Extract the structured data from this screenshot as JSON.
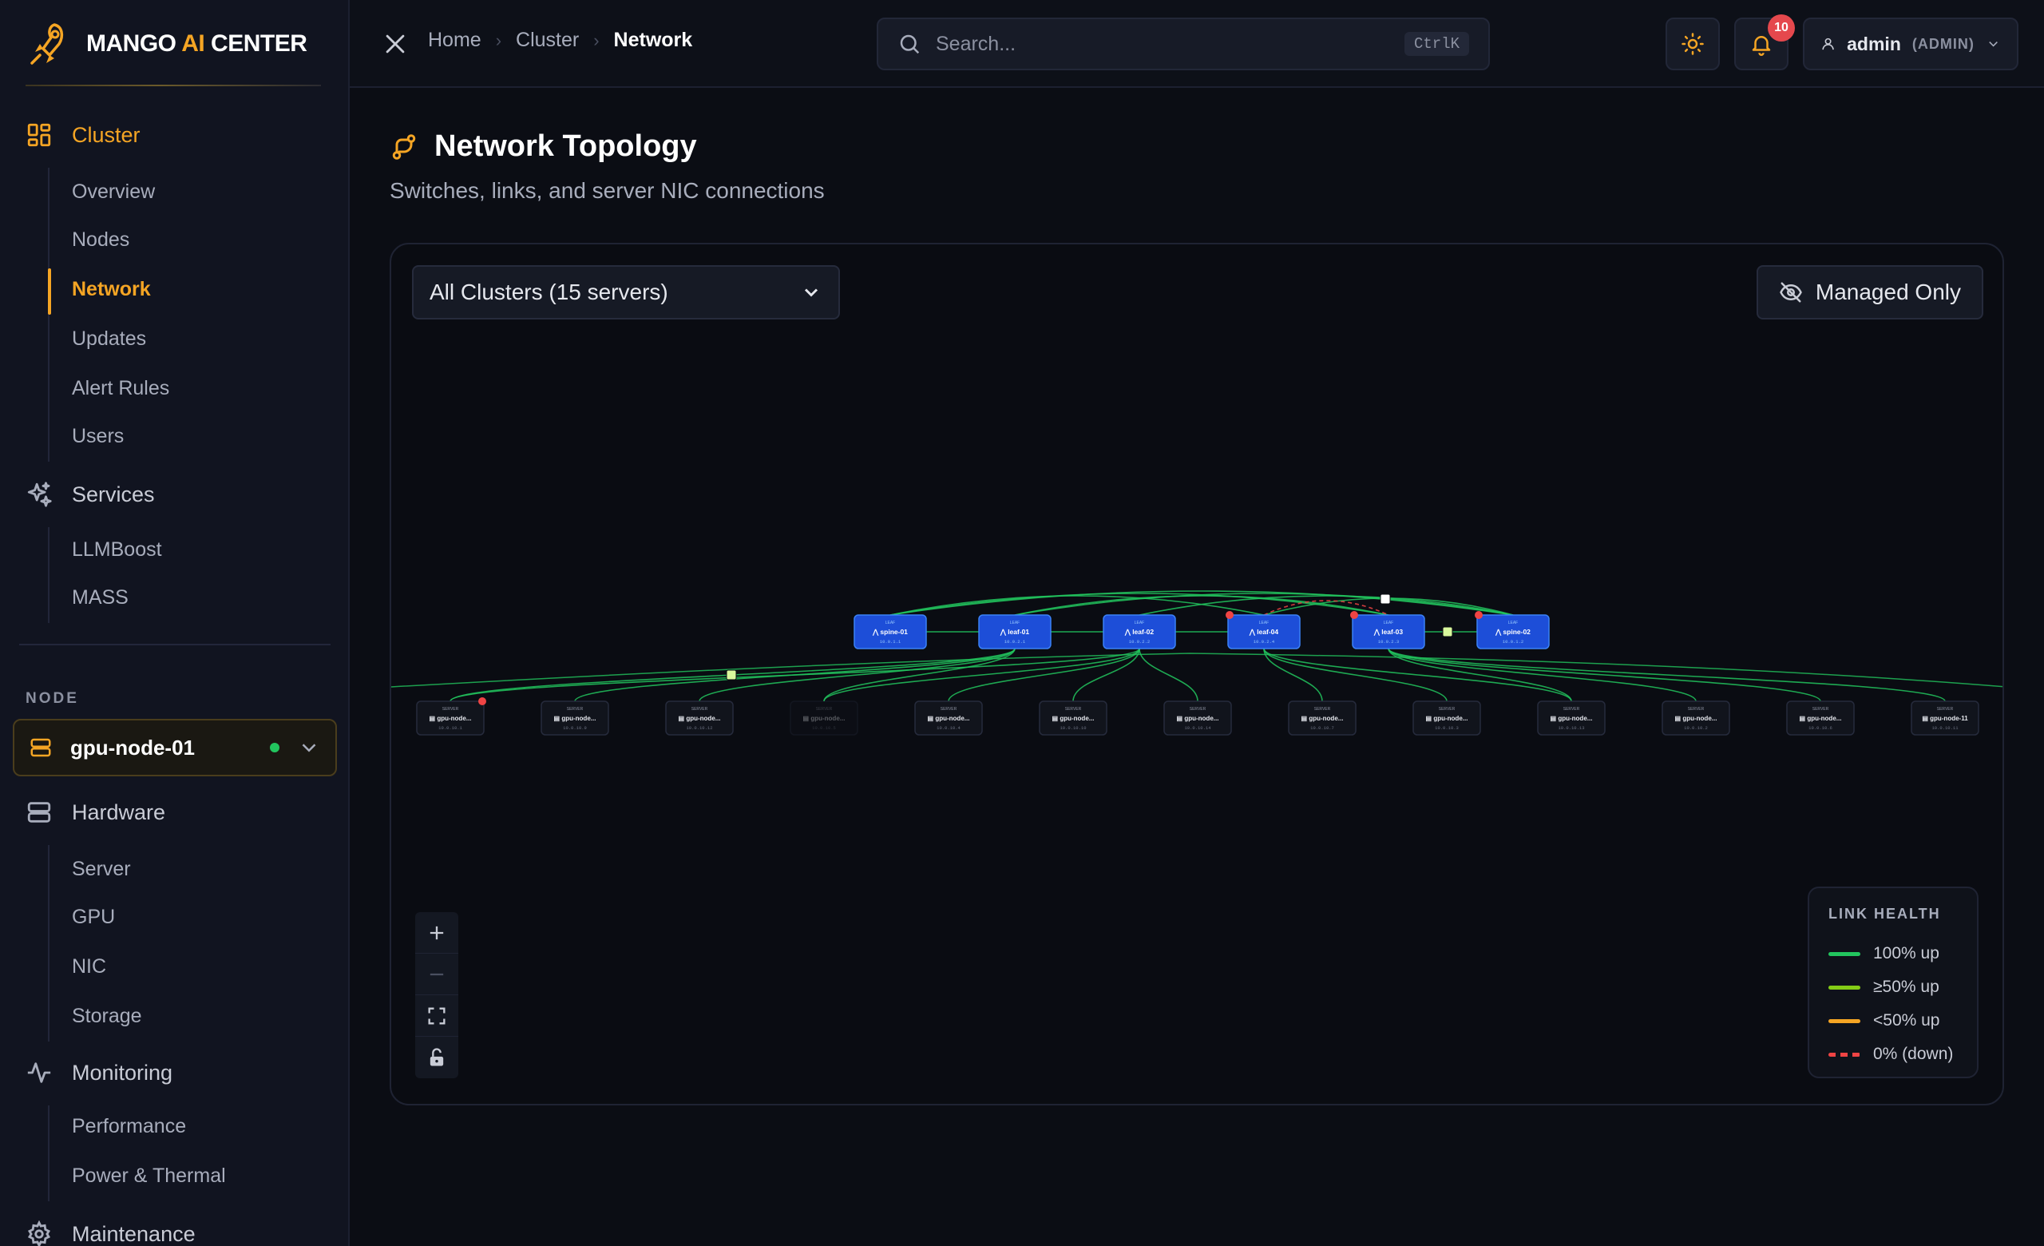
{
  "brand": {
    "name_pre": "MANGO ",
    "name_ai": "AI",
    "name_post": " CENTER"
  },
  "sidebar": {
    "cluster": {
      "label": "Cluster",
      "items": [
        "Overview",
        "Nodes",
        "Network",
        "Updates",
        "Alert Rules",
        "Users"
      ],
      "active": "Network"
    },
    "services": {
      "label": "Services",
      "items": [
        "LLMBoost",
        "MASS"
      ]
    },
    "node_label": "NODE",
    "node_select": {
      "value": "gpu-node-01",
      "status_color": "#22c55e"
    },
    "hardware": {
      "label": "Hardware",
      "items": [
        "Server",
        "GPU",
        "NIC",
        "Storage"
      ]
    },
    "monitoring": {
      "label": "Monitoring",
      "items": [
        "Performance",
        "Power & Thermal"
      ]
    },
    "maintenance": {
      "label": "Maintenance"
    }
  },
  "topbar": {
    "breadcrumb": [
      "Home",
      "Cluster",
      "Network"
    ],
    "search_placeholder": "Search...",
    "search_shortcut": "CtrlK",
    "notification_count": "10",
    "user": {
      "name": "admin",
      "role": "(ADMIN)"
    }
  },
  "page": {
    "title": "Network Topology",
    "subtitle": "Switches, links, and server NIC connections",
    "cluster_filter": "All Clusters (15 servers)",
    "managed_only_label": "Managed Only"
  },
  "topology": {
    "switches": [
      {
        "name": "spine-01",
        "type": "LEAF",
        "ip": "10.0.1.1",
        "alert": false
      },
      {
        "name": "leaf-01",
        "type": "LEAF",
        "ip": "10.0.2.1",
        "alert": false
      },
      {
        "name": "leaf-02",
        "type": "LEAF",
        "ip": "10.0.2.2",
        "alert": false
      },
      {
        "name": "leaf-04",
        "type": "LEAF",
        "ip": "10.0.2.4",
        "alert": true
      },
      {
        "name": "leaf-03",
        "type": "LEAF",
        "ip": "10.0.2.3",
        "alert": true
      },
      {
        "name": "spine-02",
        "type": "LEAF",
        "ip": "10.0.1.2",
        "alert": true
      }
    ],
    "servers": [
      {
        "name": "gpu-node...",
        "type": "SERVER",
        "ip": "10.0.10.1",
        "alert": true,
        "dim": false
      },
      {
        "name": "gpu-node...",
        "type": "SERVER",
        "ip": "10.0.10.9",
        "alert": false,
        "dim": false
      },
      {
        "name": "gpu-node...",
        "type": "SERVER",
        "ip": "10.0.10.12",
        "alert": false,
        "dim": false
      },
      {
        "name": "gpu-node...",
        "type": "SERVER",
        "ip": "10.0.10.5",
        "alert": false,
        "dim": true
      },
      {
        "name": "gpu-node...",
        "type": "SERVER",
        "ip": "10.0.10.4",
        "alert": false,
        "dim": false
      },
      {
        "name": "gpu-node...",
        "type": "SERVER",
        "ip": "10.0.10.10",
        "alert": false,
        "dim": false
      },
      {
        "name": "gpu-node...",
        "type": "SERVER",
        "ip": "10.0.10.14",
        "alert": false,
        "dim": false
      },
      {
        "name": "gpu-node...",
        "type": "SERVER",
        "ip": "10.0.10.7",
        "alert": false,
        "dim": false
      },
      {
        "name": "gpu-node...",
        "type": "SERVER",
        "ip": "10.0.10.3",
        "alert": false,
        "dim": false
      },
      {
        "name": "gpu-node...",
        "type": "SERVER",
        "ip": "10.0.10.13",
        "alert": false,
        "dim": false
      },
      {
        "name": "gpu-node...",
        "type": "SERVER",
        "ip": "10.0.10.2",
        "alert": false,
        "dim": false
      },
      {
        "name": "gpu-node...",
        "type": "SERVER",
        "ip": "10.0.10.6",
        "alert": false,
        "dim": false
      },
      {
        "name": "gpu-node-11",
        "type": "SERVER",
        "ip": "10.0.10.11",
        "alert": false,
        "dim": false
      }
    ],
    "links": [
      {
        "from": 0,
        "to": 1,
        "kind": "switch",
        "health": "up"
      },
      {
        "from": 1,
        "to": 2,
        "kind": "switch",
        "health": "up"
      },
      {
        "from": 2,
        "to": 3,
        "kind": "switch",
        "health": "up"
      },
      {
        "from": 4,
        "to": 5,
        "kind": "switch",
        "health": "up"
      },
      {
        "from": 0,
        "to": 4,
        "kind": "switch",
        "health": "up"
      },
      {
        "from": 0,
        "to": 5,
        "kind": "switch",
        "health": "up"
      },
      {
        "from": 1,
        "to": 5,
        "kind": "switch",
        "health": "up"
      },
      {
        "from": 1,
        "to": 4,
        "kind": "switch",
        "health": "up"
      },
      {
        "from": 2,
        "to": 5,
        "kind": "switch",
        "health": "up"
      },
      {
        "from": 3,
        "to": 5,
        "kind": "switch",
        "health": "up"
      },
      {
        "from": 0,
        "to": 3,
        "kind": "switch",
        "health": "up"
      },
      {
        "from": 3,
        "to": 4,
        "kind": "switch",
        "health": "down"
      },
      {
        "from": 1,
        "to": 0,
        "kind": "server",
        "health": "up"
      },
      {
        "from": 1,
        "to": 1,
        "kind": "server",
        "health": "up"
      },
      {
        "from": 1,
        "to": 2,
        "kind": "server",
        "health": "up"
      },
      {
        "from": 1,
        "to": 3,
        "kind": "server",
        "health": "up"
      },
      {
        "from": 2,
        "to": 0,
        "kind": "server",
        "health": "up"
      },
      {
        "from": 2,
        "to": 3,
        "kind": "server",
        "health": "up"
      },
      {
        "from": 2,
        "to": 4,
        "kind": "server",
        "health": "up"
      },
      {
        "from": 2,
        "to": 5,
        "kind": "server",
        "health": "up"
      },
      {
        "from": 2,
        "to": 6,
        "kind": "server",
        "health": "up"
      },
      {
        "from": 3,
        "to": 7,
        "kind": "server",
        "health": "up"
      },
      {
        "from": 3,
        "to": 8,
        "kind": "server",
        "health": "up"
      },
      {
        "from": 3,
        "to": 9,
        "kind": "server",
        "health": "up"
      },
      {
        "from": 4,
        "to": 9,
        "kind": "server",
        "health": "up"
      },
      {
        "from": 4,
        "to": 10,
        "kind": "server",
        "health": "up"
      },
      {
        "from": 4,
        "to": 11,
        "kind": "server",
        "health": "up"
      },
      {
        "from": 4,
        "to": 12,
        "kind": "server",
        "health": "up"
      }
    ]
  },
  "legend": {
    "title": "LINK HEALTH",
    "items": [
      {
        "label": "100% up",
        "color": "#22c55e",
        "style": "solid"
      },
      {
        "label": "≥50% up",
        "color": "#84cc16",
        "style": "solid"
      },
      {
        "label": "<50% up",
        "color": "#f5a524",
        "style": "solid"
      },
      {
        "label": "0% (down)",
        "color": "#ef4444",
        "style": "dashed"
      }
    ]
  },
  "colors": {
    "accent": "#f5a524",
    "switch": "#1d4ed8",
    "link_up": "#22c55e",
    "link_down": "#ef4444"
  }
}
